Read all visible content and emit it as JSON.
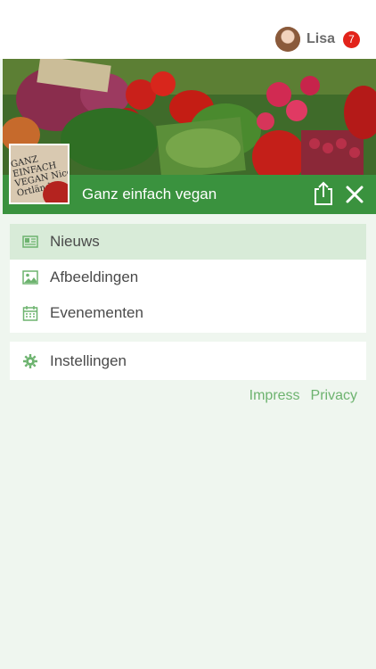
{
  "user": {
    "name": "Lisa",
    "notification_count": "7"
  },
  "feed": {
    "title": "Ganz einfach vegan",
    "thumb_text": "GANZ EINFACH VEGAN Nico Ortländer"
  },
  "menu_main": [
    {
      "label": "Nieuws",
      "icon": "news-icon",
      "active": true
    },
    {
      "label": "Afbeeldingen",
      "icon": "image-icon",
      "active": false
    },
    {
      "label": "Evenementen",
      "icon": "calendar-icon",
      "active": false
    }
  ],
  "menu_settings": {
    "label": "Instellingen",
    "icon": "gear-icon"
  },
  "links": {
    "impress": "Impress",
    "privacy": "Privacy"
  },
  "colors": {
    "brand_green": "#3a923e",
    "link_green": "#6db36f",
    "badge_red": "#e2231a",
    "page_bg": "#eff6ef",
    "active_item_bg": "#d8ebd8"
  }
}
